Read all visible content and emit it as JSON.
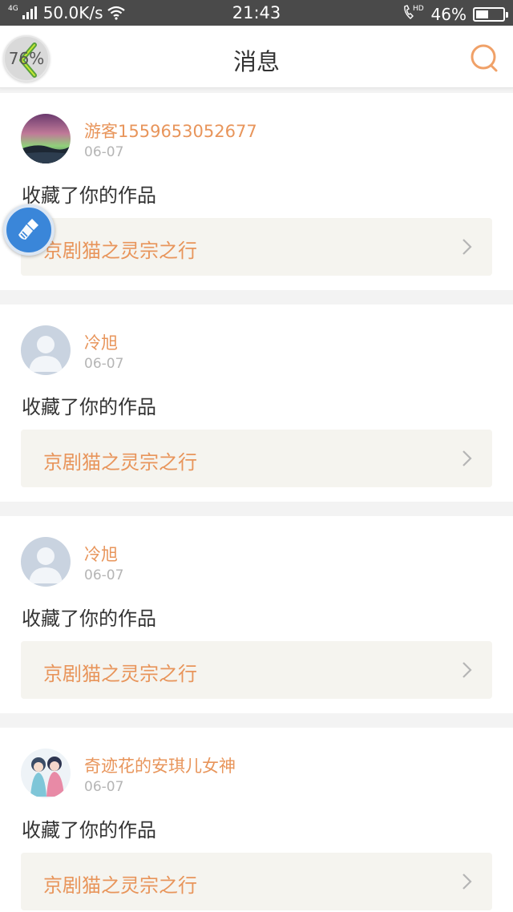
{
  "status_bar": {
    "network_type": "4G",
    "speed": "50.0K/s",
    "time": "21:43",
    "call_badge": "HD",
    "battery_text": "46%",
    "battery_level": 0.46
  },
  "header": {
    "title": "消息",
    "zoom_label": "76%",
    "accent_color": "#f0a168"
  },
  "feed": [
    {
      "username": "游客1559653052677",
      "date": "06-07",
      "action": "收藏了你的作品",
      "work_title": "京剧猫之灵宗之行",
      "avatar": "aurora-landscape-avatar"
    },
    {
      "username": "冷旭",
      "date": "06-07",
      "action": "收藏了你的作品",
      "work_title": "京剧猫之灵宗之行",
      "avatar": "default-person-avatar"
    },
    {
      "username": "冷旭",
      "date": "06-07",
      "action": "收藏了你的作品",
      "work_title": "京剧猫之灵宗之行",
      "avatar": "default-person-avatar"
    },
    {
      "username": "奇迹花的安琪儿女神",
      "date": "06-07",
      "action": "收藏了你的作品",
      "work_title": "京剧猫之灵宗之行",
      "avatar": "anime-characters-avatar"
    }
  ],
  "floating": {
    "clean_icon": "broom-icon"
  }
}
